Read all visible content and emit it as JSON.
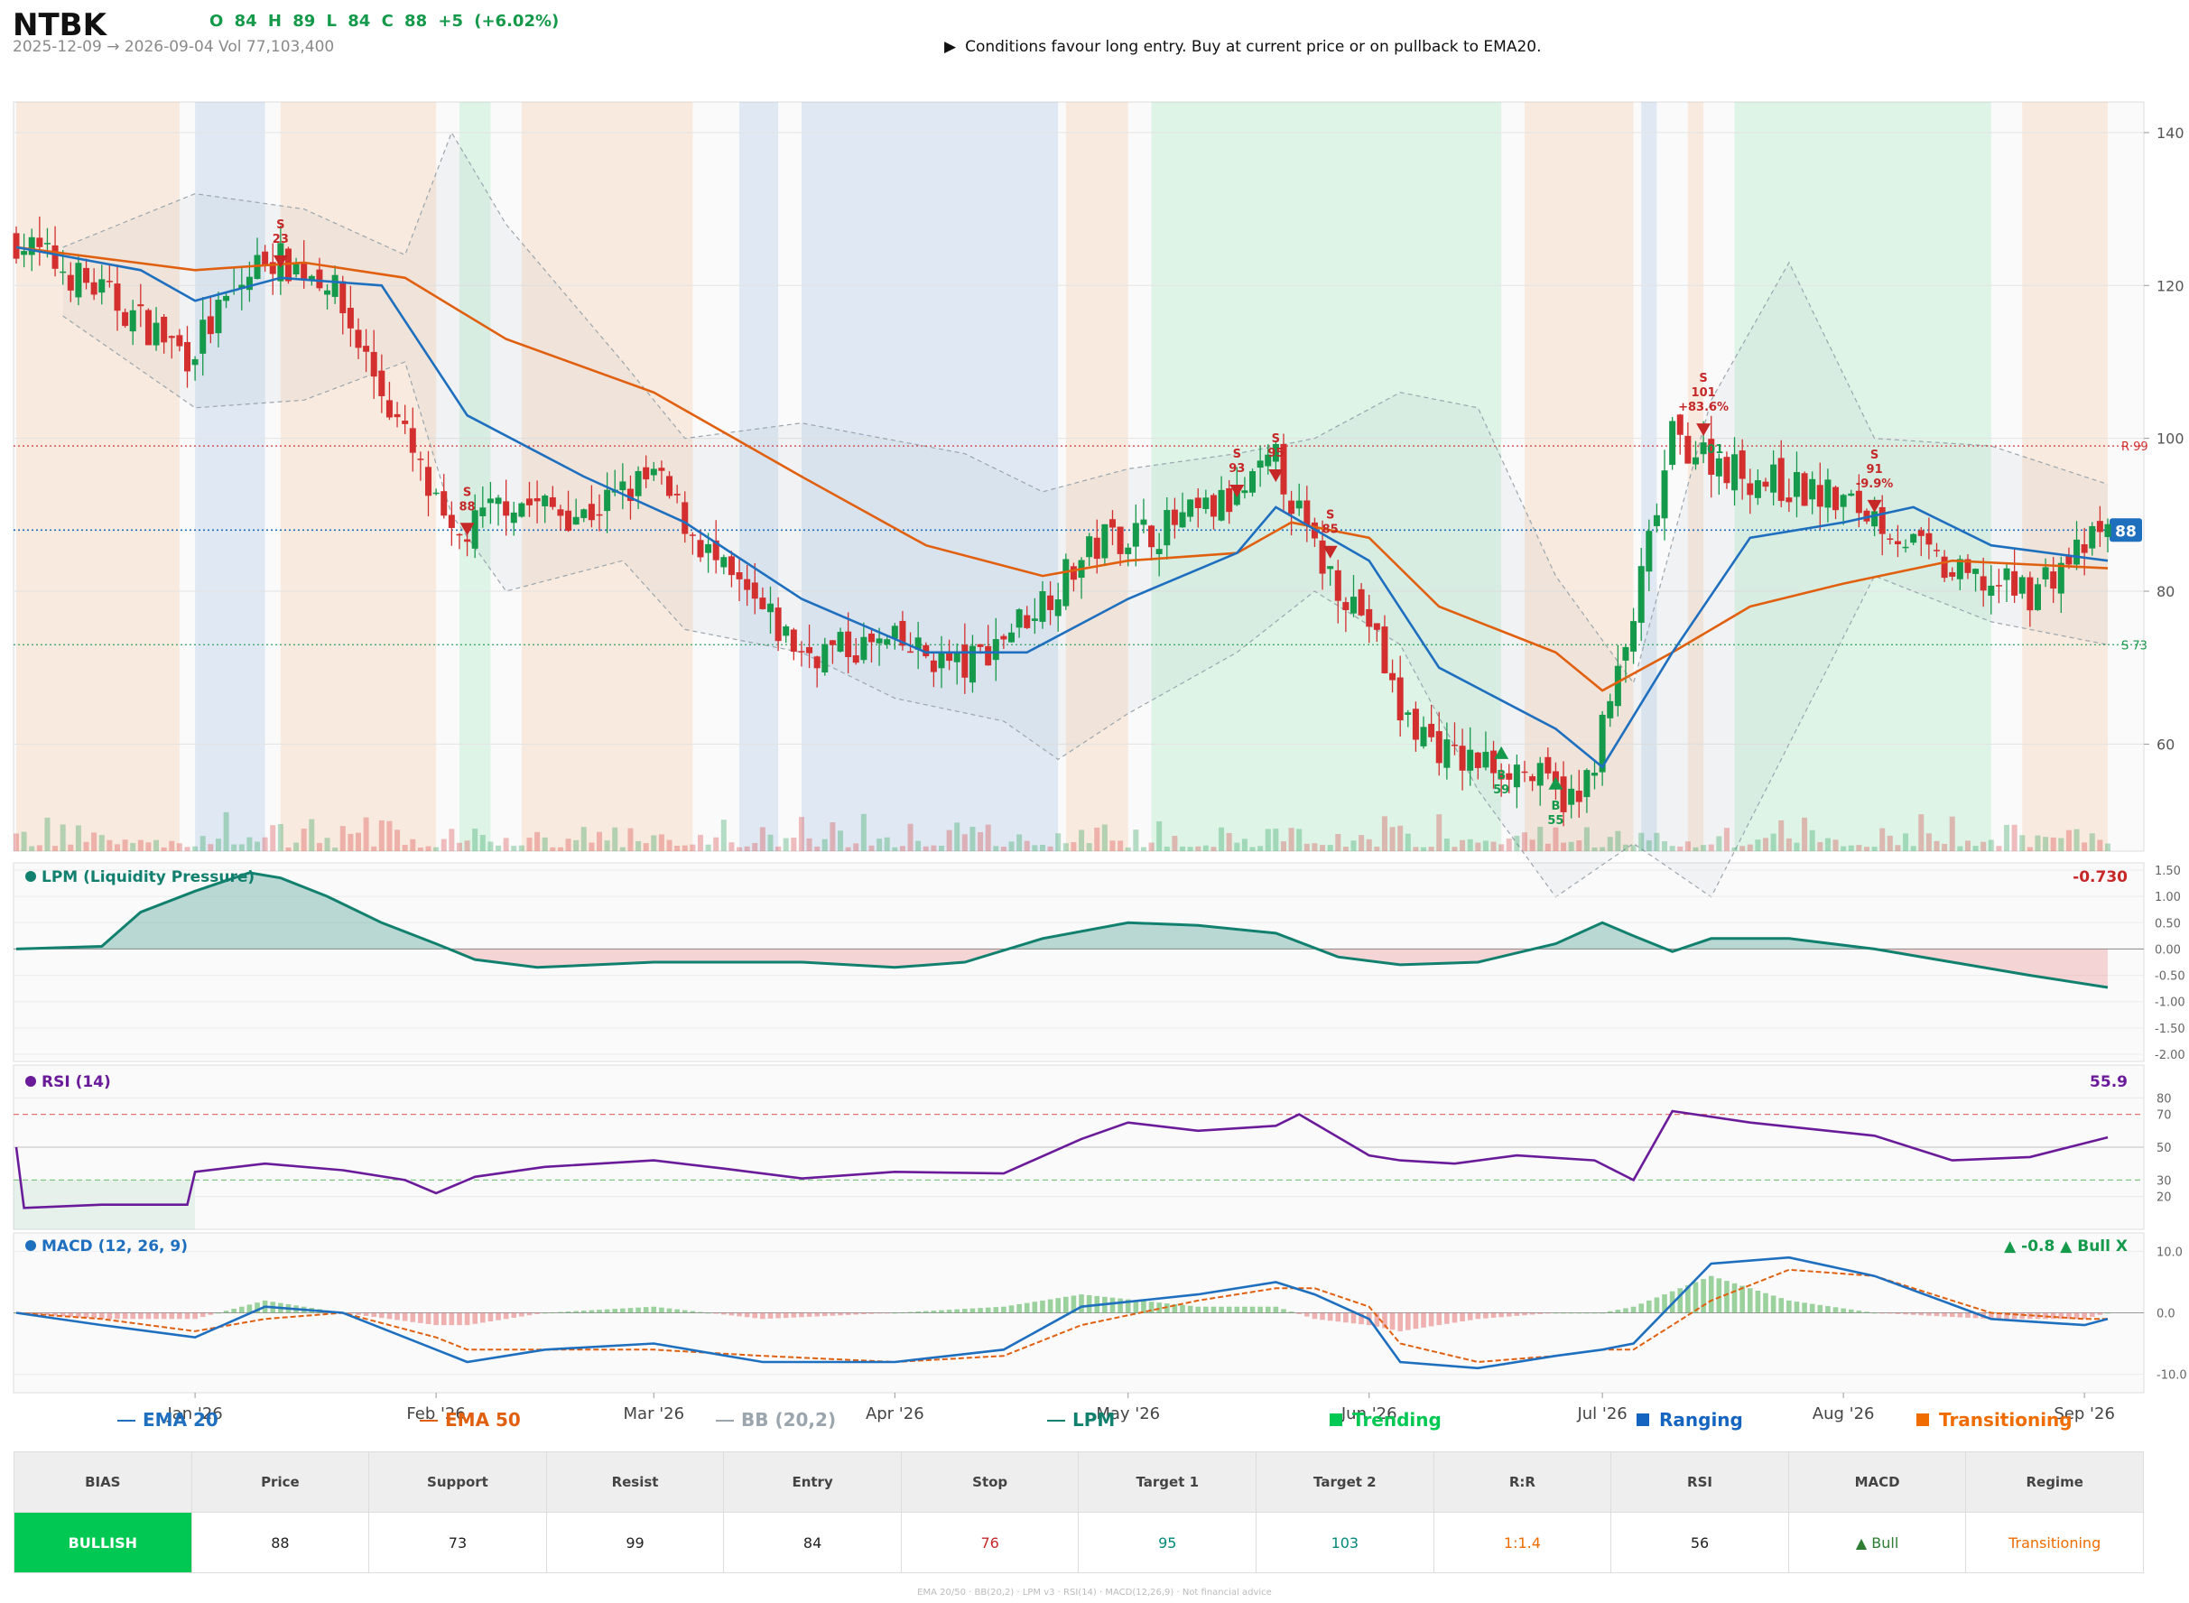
{
  "header": {
    "ticker": "NTBK",
    "ohlc": "O 84   H 89   L 84   C 88   +5  (+6.02%)",
    "subline": "2025-12-09 → 2026-09-04   Vol 77,103,400",
    "message": "Conditions favour long entry. Buy at current price or on pullback to EMA20.",
    "message_icon": "play-arrow-icon"
  },
  "colors": {
    "trending": "#00c853",
    "ranging": "#1565c0",
    "transitioning": "#ef6c00",
    "up": "#15994a",
    "down": "#d32f2f",
    "ema20": "#1f6fbf",
    "ema50": "#e06010",
    "lpm": "#12806f",
    "rsi": "#6a1b9a",
    "macd": "#1f6fbf",
    "signal": "#e06010"
  },
  "chart_data": [
    {
      "type": "candlestick",
      "panel": "price",
      "x_range": [
        "2025-12-09",
        "2026-09-04"
      ],
      "ylim": [
        46,
        144
      ],
      "y_ticks": [
        60,
        80,
        100,
        120,
        140
      ],
      "x_tick_labels": [
        "Jan '26",
        "Feb '26",
        "Mar '26",
        "Apr '26",
        "May '26",
        "Jun '26",
        "Jul '26",
        "Aug '26",
        "Sep '26"
      ],
      "x_tick_dates": [
        "2026-01-01",
        "2026-02-01",
        "2026-03-01",
        "2026-04-01",
        "2026-05-01",
        "2026-06-01",
        "2026-07-01",
        "2026-08-01",
        "2026-09-01"
      ],
      "close_trajectory": {
        "dates": [
          "2025-12-09",
          "2025-12-20",
          "2025-12-31",
          "2026-01-10",
          "2026-01-18",
          "2026-01-28",
          "2026-02-03",
          "2026-02-10",
          "2026-02-20",
          "2026-03-01",
          "2026-03-10",
          "2026-03-20",
          "2026-04-01",
          "2026-04-10",
          "2026-04-18",
          "2026-04-28",
          "2026-05-05",
          "2026-05-15",
          "2026-05-20",
          "2026-05-25",
          "2026-06-01",
          "2026-06-05",
          "2026-06-12",
          "2026-06-20",
          "2026-06-28",
          "2026-07-04",
          "2026-07-10",
          "2026-07-20",
          "2026-07-31",
          "2026-08-05",
          "2026-08-15",
          "2026-08-25",
          "2026-09-04"
        ],
        "values": [
          126,
          119,
          111,
          124,
          121,
          100,
          86,
          92,
          90,
          95,
          82,
          72,
          73,
          70,
          77,
          87,
          88,
          92,
          97,
          85,
          76,
          64,
          58,
          57,
          52,
          72,
          100,
          95,
          92,
          90,
          82,
          80,
          88
        ]
      },
      "ema20": {
        "dates": [
          "2025-12-09",
          "2025-12-25",
          "2026-01-01",
          "2026-01-12",
          "2026-01-25",
          "2026-02-05",
          "2026-02-20",
          "2026-03-05",
          "2026-03-20",
          "2026-04-05",
          "2026-04-18",
          "2026-05-01",
          "2026-05-15",
          "2026-05-20",
          "2026-06-01",
          "2026-06-10",
          "2026-06-25",
          "2026-07-01",
          "2026-07-10",
          "2026-07-20",
          "2026-08-01",
          "2026-08-10",
          "2026-08-20",
          "2026-09-04"
        ],
        "values": [
          125,
          122,
          118,
          121,
          120,
          103,
          95,
          89,
          79,
          72,
          72,
          79,
          85,
          91,
          84,
          70,
          62,
          57,
          72,
          87,
          89,
          91,
          86,
          84
        ]
      },
      "ema50": {
        "dates": [
          "2025-12-09",
          "2026-01-01",
          "2026-01-15",
          "2026-01-28",
          "2026-02-10",
          "2026-03-01",
          "2026-03-20",
          "2026-04-05",
          "2026-04-20",
          "2026-05-01",
          "2026-05-15",
          "2026-05-22",
          "2026-06-01",
          "2026-06-10",
          "2026-06-25",
          "2026-07-01",
          "2026-07-10",
          "2026-07-20",
          "2026-08-01",
          "2026-08-15",
          "2026-09-04"
        ],
        "values": [
          125,
          122,
          123,
          121,
          113,
          106,
          95,
          86,
          82,
          84,
          85,
          89,
          87,
          78,
          72,
          67,
          72,
          78,
          81,
          84,
          83
        ]
      },
      "bb_upper": {
        "dates": [
          "2025-12-15",
          "2026-01-01",
          "2026-01-15",
          "2026-01-28",
          "2026-02-03",
          "2026-02-10",
          "2026-02-25",
          "2026-03-05",
          "2026-03-20",
          "2026-04-10",
          "2026-04-20",
          "2026-05-01",
          "2026-05-15",
          "2026-05-25",
          "2026-06-05",
          "2026-06-15",
          "2026-06-25",
          "2026-07-05",
          "2026-07-15",
          "2026-07-25",
          "2026-08-05",
          "2026-08-20",
          "2026-09-04"
        ],
        "values": [
          125,
          132,
          130,
          124,
          140,
          128,
          110,
          100,
          102,
          98,
          93,
          96,
          98,
          100,
          106,
          104,
          82,
          68,
          105,
          123,
          100,
          99,
          94
        ]
      },
      "bb_lower": {
        "dates": [
          "2025-12-15",
          "2026-01-01",
          "2026-01-15",
          "2026-01-28",
          "2026-02-03",
          "2026-02-10",
          "2026-02-25",
          "2026-03-05",
          "2026-03-20",
          "2026-04-01",
          "2026-04-15",
          "2026-04-22",
          "2026-05-01",
          "2026-05-15",
          "2026-05-25",
          "2026-06-05",
          "2026-06-15",
          "2026-06-25",
          "2026-07-05",
          "2026-07-15",
          "2026-07-25",
          "2026-08-05",
          "2026-08-20",
          "2026-09-04"
        ],
        "values": [
          116,
          104,
          105,
          110,
          90,
          80,
          84,
          75,
          72,
          66,
          63,
          58,
          64,
          72,
          80,
          73,
          54,
          40,
          47,
          40,
          60,
          82,
          76,
          73
        ]
      },
      "levels": [
        {
          "label": "R 99",
          "value": 99,
          "color": "#d32f2f"
        },
        {
          "label": "S 73",
          "value": 73,
          "color": "#15994a"
        },
        {
          "label": "88",
          "value": 88,
          "color": "#1f6fbf"
        }
      ],
      "regimes": [
        {
          "start": "2025-12-09",
          "end": "2025-12-30",
          "regime": "transitioning"
        },
        {
          "start": "2026-01-01",
          "end": "2026-01-10",
          "regime": "ranging"
        },
        {
          "start": "2026-01-12",
          "end": "2026-02-01",
          "regime": "transitioning"
        },
        {
          "start": "2026-02-04",
          "end": "2026-02-08",
          "regime": "trending"
        },
        {
          "start": "2026-02-12",
          "end": "2026-03-06",
          "regime": "transitioning"
        },
        {
          "start": "2026-03-12",
          "end": "2026-03-17",
          "regime": "ranging"
        },
        {
          "start": "2026-03-20",
          "end": "2026-04-22",
          "regime": "ranging"
        },
        {
          "start": "2026-04-23",
          "end": "2026-05-01",
          "regime": "transitioning"
        },
        {
          "start": "2026-05-04",
          "end": "2026-06-18",
          "regime": "trending"
        },
        {
          "start": "2026-06-21",
          "end": "2026-07-05",
          "regime": "transitioning"
        },
        {
          "start": "2026-07-06",
          "end": "2026-07-08",
          "regime": "ranging"
        },
        {
          "start": "2026-07-12",
          "end": "2026-07-14",
          "regime": "transitioning"
        },
        {
          "start": "2026-07-18",
          "end": "2026-08-20",
          "regime": "trending"
        },
        {
          "start": "2026-08-24",
          "end": "2026-09-04",
          "regime": "transitioning"
        }
      ],
      "signals": [
        {
          "date": "2026-01-12",
          "price": 123,
          "side": "S",
          "text": [
            "S",
            "23"
          ]
        },
        {
          "date": "2026-02-05",
          "price": 88,
          "side": "S",
          "text": [
            "S",
            "88"
          ]
        },
        {
          "date": "2026-05-15",
          "price": 93,
          "side": "S",
          "text": [
            "S",
            "93"
          ]
        },
        {
          "date": "2026-05-20",
          "price": 95,
          "side": "S",
          "text": [
            "S",
            "95"
          ]
        },
        {
          "date": "2026-05-27",
          "price": 85,
          "side": "S",
          "text": [
            "S",
            "85"
          ]
        },
        {
          "date": "2026-06-18",
          "price": 59,
          "side": "B",
          "text": [
            "B",
            "59"
          ]
        },
        {
          "date": "2026-06-25",
          "price": 55,
          "side": "B",
          "text": [
            "B",
            "55"
          ]
        },
        {
          "date": "2026-07-14",
          "price": 101,
          "side": "S",
          "text": [
            "S",
            "101",
            "+83.6%"
          ]
        },
        {
          "date": "2026-07-15",
          "price": 101,
          "side": "B",
          "text": [
            "101"
          ]
        },
        {
          "date": "2026-08-05",
          "price": 91,
          "side": "S",
          "text": [
            "S",
            "91",
            "-9.9%"
          ]
        }
      ]
    },
    {
      "type": "area",
      "panel": "lpm",
      "title": "LPM (Liquidity Pressure)",
      "last_value": "-0.730",
      "ylim": [
        -2,
        1.5
      ],
      "y_ticks": [
        1.5,
        1.0,
        0.5,
        0.0,
        -0.5,
        -1.0,
        -1.5,
        -2.0
      ],
      "y_tick_labels": [
        "1.50",
        "1.00",
        "0.50",
        "0.00",
        "-0.50",
        "-1.00",
        "-1.50",
        "-2.00"
      ],
      "x": [
        "2025-12-09",
        "2025-12-20",
        "2025-12-25",
        "2026-01-01",
        "2026-01-08",
        "2026-01-12",
        "2026-01-18",
        "2026-01-25",
        "2026-02-01",
        "2026-02-06",
        "2026-02-14",
        "2026-03-01",
        "2026-03-20",
        "2026-04-01",
        "2026-04-10",
        "2026-04-20",
        "2026-05-01",
        "2026-05-10",
        "2026-05-20",
        "2026-05-28",
        "2026-06-05",
        "2026-06-15",
        "2026-06-25",
        "2026-07-01",
        "2026-07-05",
        "2026-07-10",
        "2026-07-15",
        "2026-07-25",
        "2026-08-05",
        "2026-08-15",
        "2026-08-25",
        "2026-09-04"
      ],
      "values": [
        0.0,
        0.05,
        0.7,
        1.1,
        1.45,
        1.35,
        1.0,
        0.5,
        0.1,
        -0.2,
        -0.35,
        -0.25,
        -0.25,
        -0.35,
        -0.25,
        0.2,
        0.5,
        0.45,
        0.3,
        -0.15,
        -0.3,
        -0.25,
        0.1,
        0.5,
        0.25,
        -0.05,
        0.2,
        0.2,
        0.0,
        -0.25,
        -0.5,
        -0.73
      ]
    },
    {
      "type": "line",
      "panel": "rsi",
      "title": "RSI (14)",
      "last_value": "55.9",
      "ylim": [
        0,
        100
      ],
      "y_ticks": [
        80,
        70,
        50,
        30,
        20
      ],
      "x": [
        "2025-12-09",
        "2025-12-10",
        "2025-12-20",
        "2025-12-31",
        "2026-01-01",
        "2026-01-10",
        "2026-01-20",
        "2026-01-28",
        "2026-02-01",
        "2026-02-06",
        "2026-02-15",
        "2026-03-01",
        "2026-03-10",
        "2026-03-20",
        "2026-04-01",
        "2026-04-15",
        "2026-04-25",
        "2026-05-01",
        "2026-05-10",
        "2026-05-20",
        "2026-05-23",
        "2026-06-01",
        "2026-06-05",
        "2026-06-12",
        "2026-06-20",
        "2026-06-30",
        "2026-07-05",
        "2026-07-10",
        "2026-07-20",
        "2026-07-30",
        "2026-08-05",
        "2026-08-15",
        "2026-08-25",
        "2026-09-04"
      ],
      "values": [
        50,
        13,
        15,
        15,
        35,
        40,
        36,
        30,
        22,
        32,
        38,
        42,
        37,
        31,
        35,
        34,
        55,
        65,
        60,
        63,
        70,
        45,
        42,
        40,
        45,
        42,
        30,
        72,
        65,
        60,
        57,
        42,
        44,
        56
      ]
    },
    {
      "type": "line",
      "panel": "macd",
      "title": "MACD (12, 26, 9)",
      "status": "▲ -0.8 ▲ Bull X",
      "ylim": [
        -13,
        13
      ],
      "y_ticks": [
        10,
        0,
        -10
      ],
      "y_tick_labels": [
        "10.0",
        "0.0",
        "-10.0"
      ],
      "x": [
        "2025-12-09",
        "2025-12-20",
        "2026-01-01",
        "2026-01-10",
        "2026-01-20",
        "2026-02-01",
        "2026-02-05",
        "2026-02-15",
        "2026-03-01",
        "2026-03-15",
        "2026-04-01",
        "2026-04-15",
        "2026-04-25",
        "2026-05-10",
        "2026-05-20",
        "2026-05-25",
        "2026-06-01",
        "2026-06-05",
        "2026-06-15",
        "2026-06-25",
        "2026-07-01",
        "2026-07-05",
        "2026-07-15",
        "2026-07-25",
        "2026-08-05",
        "2026-08-20",
        "2026-09-01",
        "2026-09-04"
      ],
      "macd": [
        0,
        -2,
        -4,
        1,
        0,
        -6,
        -8,
        -6,
        -5,
        -8,
        -8,
        -6,
        1,
        3,
        5,
        3,
        -1,
        -8,
        -9,
        -7,
        -6,
        -5,
        8,
        9,
        6,
        -1,
        -2,
        -1
      ],
      "signal": [
        0,
        -1,
        -3,
        -1,
        0,
        -4,
        -6,
        -6,
        -6,
        -7,
        -8,
        -7,
        -2,
        2,
        4,
        4,
        1,
        -5,
        -8,
        -7,
        -6,
        -6,
        2,
        7,
        6,
        0,
        -1,
        -1
      ]
    }
  ],
  "legend": [
    {
      "label": "EMA 20",
      "kind": "line",
      "color": "#1f6fbf"
    },
    {
      "label": "EMA 50",
      "kind": "line",
      "color": "#e06010"
    },
    {
      "label": "BB (20,2)",
      "kind": "line",
      "color": "#9aa5ad"
    },
    {
      "label": "LPM",
      "kind": "line",
      "color": "#12806f"
    },
    {
      "label": "Trending",
      "kind": "square",
      "color": "#00c853"
    },
    {
      "label": "Ranging",
      "kind": "square",
      "color": "#1565c0"
    },
    {
      "label": "Transitioning",
      "kind": "square",
      "color": "#ef6c00"
    }
  ],
  "table": {
    "headers": [
      "BIAS",
      "Price",
      "Support",
      "Resist",
      "Entry",
      "Stop",
      "Target 1",
      "Target 2",
      "R:R",
      "RSI",
      "MACD",
      "Regime"
    ],
    "values": [
      "BULLISH",
      "88",
      "73",
      "99",
      "84",
      "76",
      "95",
      "103",
      "1:1.4",
      "56",
      "▲ Bull",
      "Transitioning"
    ],
    "value_colors": [
      "#ffffff",
      "#222222",
      "#222222",
      "#222222",
      "#222222",
      "#c62828",
      "#00897b",
      "#00897b",
      "#ef6c00",
      "#222222",
      "#2e7d32",
      "#ef6c00"
    ]
  },
  "footer": "EMA 20/50 · BB(20,2) · LPM v3 · RSI(14) · MACD(12,26,9) · Not financial advice"
}
